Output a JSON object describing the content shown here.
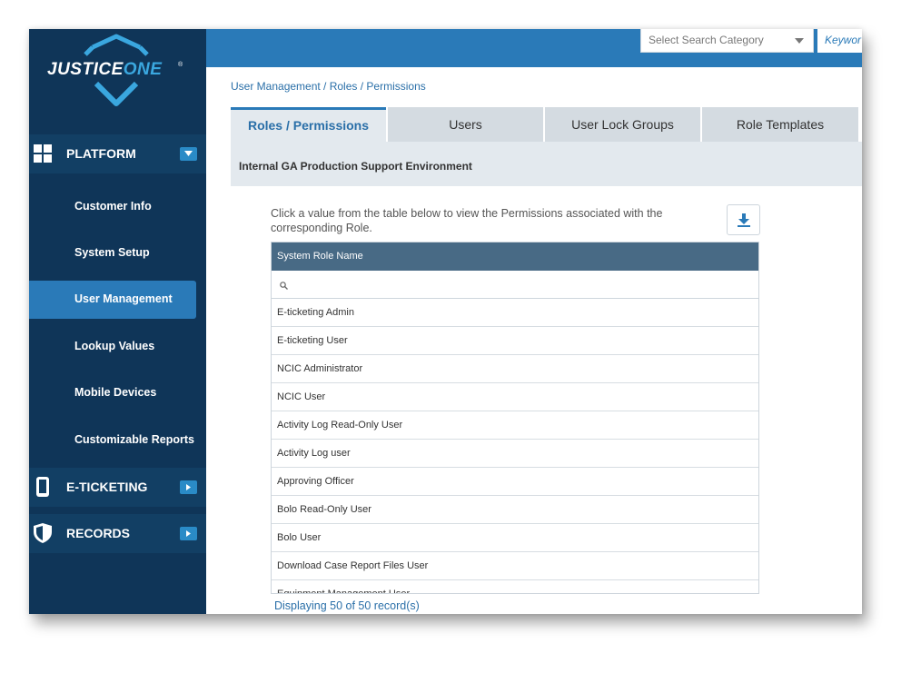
{
  "brand": {
    "name_part1": "JUSTICE",
    "name_part2": "ONE",
    "mark": "®"
  },
  "search": {
    "category_placeholder": "Select Search Category",
    "keyword_placeholder": "Keywor"
  },
  "sidebar": {
    "sections": [
      {
        "label": "PLATFORM",
        "icon": "grid-icon",
        "expanded": true
      },
      {
        "label": "E-TICKETING",
        "icon": "phone-icon",
        "expanded": false
      },
      {
        "label": "RECORDS",
        "icon": "shield-icon",
        "expanded": false
      }
    ],
    "items": [
      {
        "label": "Customer Info"
      },
      {
        "label": "System Setup"
      },
      {
        "label": "User Management",
        "active": true
      },
      {
        "label": "Lookup Values"
      },
      {
        "label": "Mobile Devices"
      },
      {
        "label": "Customizable Reports"
      }
    ]
  },
  "breadcrumb": "User Management / Roles / Permissions",
  "tabs": [
    {
      "label": "Roles / Permissions",
      "active": true
    },
    {
      "label": "Users"
    },
    {
      "label": "User Lock Groups"
    },
    {
      "label": "Role Templates"
    }
  ],
  "environment": "Internal GA Production Support Environment",
  "instructions": "Click a value from the table below to view the Permissions associated with the corresponding Role.",
  "table": {
    "header": "System Role Name",
    "rows": [
      "E-ticketing Admin",
      "E-ticketing User",
      "NCIC Administrator",
      "NCIC User",
      "Activity Log Read-Only User",
      "Activity Log user",
      "Approving Officer",
      "Bolo Read-Only User",
      "Bolo User",
      "Download Case Report Files User",
      "Equipment Management User"
    ]
  },
  "footer": "Displaying 50 of 50 record(s)",
  "colors": {
    "sidebar": "#0f3558",
    "accent": "#2a7ab8",
    "header_row": "#486a85"
  }
}
